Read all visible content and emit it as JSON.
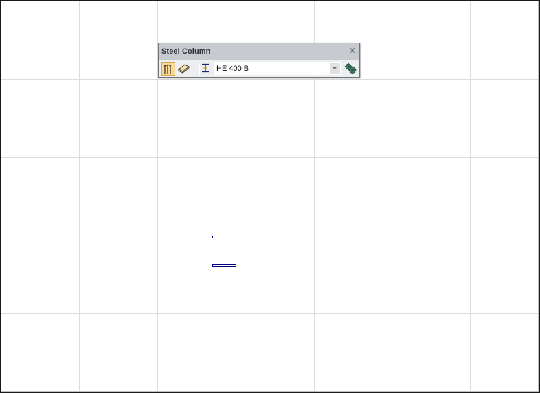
{
  "app": {
    "canvas": {
      "grid_color": "#dcdcdc",
      "grid_columns": 7,
      "grid_rows": 5
    },
    "toolbar": {
      "title": "Steel Column",
      "close_symbol": "✕",
      "tools": [
        {
          "icon": "multi-column-icon",
          "active": true
        },
        {
          "icon": "single-column-icon",
          "active": false
        },
        {
          "icon": "profile-section-icon",
          "active": false
        }
      ],
      "profile_select": {
        "selected": "HE 400 B"
      },
      "settings_icon": "settings-gears-icon"
    },
    "drawing": {
      "element": "steel-column-profile",
      "stroke_color": "#000080"
    }
  }
}
